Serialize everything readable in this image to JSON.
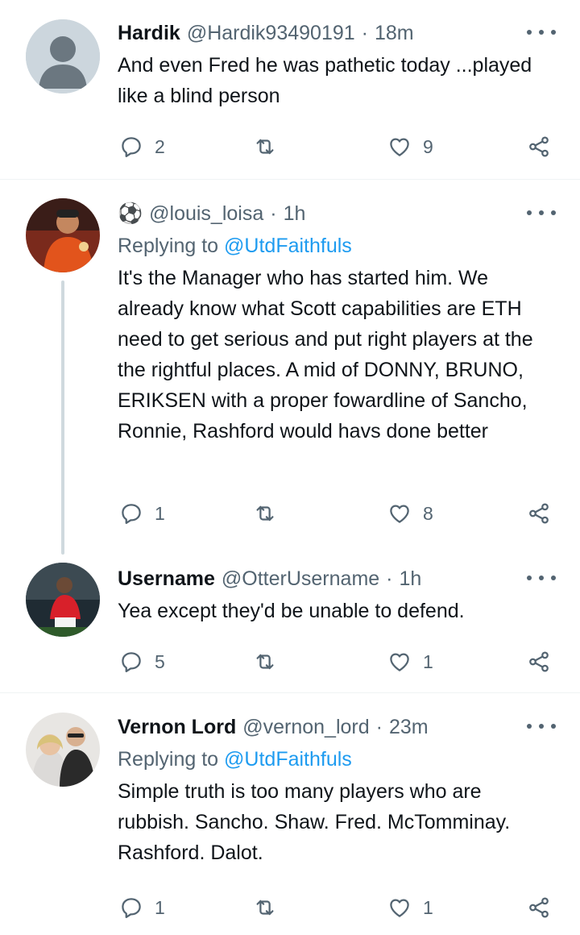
{
  "tweets": [
    {
      "name": "Hardik",
      "handle": "@Hardik93490191",
      "sep": "·",
      "time": "18m",
      "replying_prefix": "",
      "replying_to": "",
      "text": "And even Fred he was pathetic today ...played like a blind person",
      "replies": "2",
      "retweets": "",
      "likes": "9",
      "avatar": "default-avatar"
    },
    {
      "name": "⚽",
      "handle": "@louis_loisa",
      "sep": "·",
      "time": "1h",
      "replying_prefix": "Replying to ",
      "replying_to": "@UtdFaithfuls",
      "text": "It's the Manager who has started him. We already know what Scott capabilities are ETH need to get serious and put right players at the the rightful places. A mid of DONNY, BRUNO, ERIKSEN with a proper fowardline of Sancho, Ronnie, Rashford would havs done better",
      "replies": "1",
      "retweets": "",
      "likes": "8",
      "avatar": "photo-avatar"
    },
    {
      "name": "Username",
      "handle": "@OtterUsername",
      "sep": "·",
      "time": "1h",
      "replying_prefix": "",
      "replying_to": "",
      "text": "Yea except they'd be unable to defend.",
      "replies": "5",
      "retweets": "",
      "likes": "1",
      "avatar": "photo-avatar"
    },
    {
      "name": "Vernon Lord",
      "handle": "@vernon_lord",
      "sep": "·",
      "time": "23m",
      "replying_prefix": "Replying to ",
      "replying_to": "@UtdFaithfuls",
      "text": "Simple truth is too many players who are rubbish. Sancho. Shaw. Fred. McTomminay. Rashford. Dalot.",
      "replies": "1",
      "retweets": "",
      "likes": "1",
      "avatar": "photo-avatar"
    }
  ],
  "icons": {
    "reply": "reply-icon",
    "retweet": "retweet-icon",
    "like": "heart-icon",
    "share": "share-icon",
    "more": "more-icon"
  },
  "colors": {
    "text": "#0f1419",
    "secondary": "#536471",
    "link": "#1d9bf0",
    "divider": "#eff3f4",
    "thread_line": "#cfd9de"
  }
}
